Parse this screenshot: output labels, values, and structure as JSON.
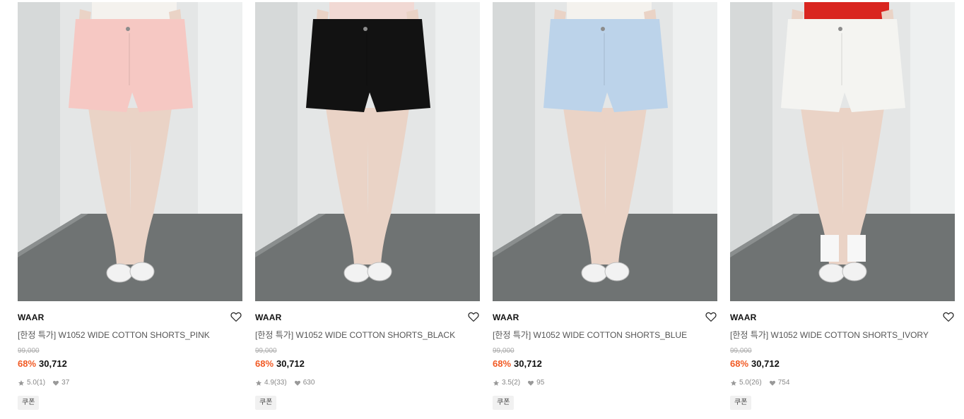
{
  "products": [
    {
      "brand": "WAAR",
      "title": "[한정 특가] W1052 WIDE COTTON SHORTS_PINK",
      "original_price": "99,000",
      "discount": "68%",
      "price": "30,712",
      "rating": "5.0",
      "review_count": "(1)",
      "likes": "37",
      "coupon": "쿠폰",
      "shorts_color": "#f6c8c3",
      "top_color": "#f4f2ee",
      "shoe_color": "#f2f2f2",
      "sock": false
    },
    {
      "brand": "WAAR",
      "title": "[한정 특가] W1052 WIDE COTTON SHORTS_BLACK",
      "original_price": "99,000",
      "discount": "68%",
      "price": "30,712",
      "rating": "4.9",
      "review_count": "(33)",
      "likes": "630",
      "coupon": "쿠폰",
      "shorts_color": "#121212",
      "top_color": "#f1d9d4",
      "shoe_color": "#f2f2f2",
      "sock": false
    },
    {
      "brand": "WAAR",
      "title": "[한정 특가] W1052 WIDE COTTON SHORTS_BLUE",
      "original_price": "99,000",
      "discount": "68%",
      "price": "30,712",
      "rating": "3.5",
      "review_count": "(2)",
      "likes": "95",
      "coupon": "쿠폰",
      "shorts_color": "#bcd3ea",
      "top_color": "#f4f2ee",
      "shoe_color": "#f2f2f2",
      "sock": false
    },
    {
      "brand": "WAAR",
      "title": "[한정 특가] W1052 WIDE COTTON SHORTS_IVORY",
      "original_price": "99,000",
      "discount": "68%",
      "price": "30,712",
      "rating": "5.0",
      "review_count": "(26)",
      "likes": "754",
      "coupon": "쿠폰",
      "shorts_color": "#f4f4f1",
      "top_color": "#d9251f",
      "shoe_color": "#f2f2f2",
      "sock": true
    }
  ],
  "colors": {
    "discount": "#f15a24",
    "wall": "#e4e6e6",
    "floor": "#6f7373",
    "skin": "#ead3c6"
  },
  "icons": {
    "wish": "heart-outline-icon",
    "rating": "star-icon",
    "likes": "heart-icon"
  }
}
